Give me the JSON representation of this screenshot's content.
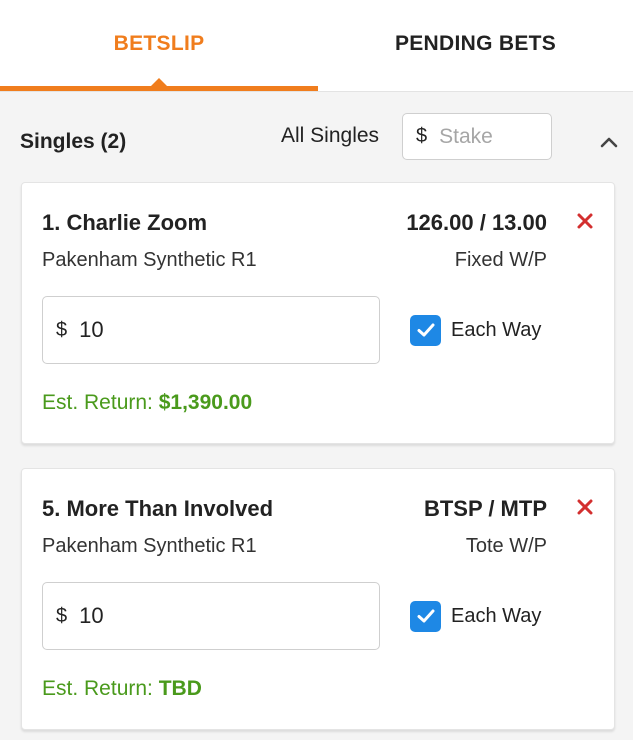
{
  "tabs": {
    "betslip": "BETSLIP",
    "pending": "PENDING BETS"
  },
  "singles": {
    "title": "Singles (2)",
    "all_singles_label": "All Singles",
    "currency": "$",
    "stake_placeholder": "Stake"
  },
  "bets": [
    {
      "runner": "1. Charlie Zoom",
      "odds": "126.00 / 13.00",
      "race": "Pakenham Synthetic R1",
      "bet_type": "Fixed W/P",
      "currency": "$",
      "stake": "10",
      "each_way_label": "Each Way",
      "each_way_checked": true,
      "est_return_label": "Est. Return:",
      "est_return_value": "$1,390.00"
    },
    {
      "runner": "5. More Than Involved",
      "odds": "BTSP / MTP",
      "race": "Pakenham Synthetic R1",
      "bet_type": "Tote W/P",
      "currency": "$",
      "stake": "10",
      "each_way_label": "Each Way",
      "each_way_checked": true,
      "est_return_label": "Est. Return:",
      "est_return_value": "TBD"
    }
  ],
  "colors": {
    "accent": "#f07d1d",
    "checkbox": "#1e88e5",
    "remove": "#d32f2f",
    "return_text": "#4a9a1c"
  },
  "icons": {
    "collapse": "chevron-up-icon",
    "remove": "close-icon",
    "checkbox": "checkmark-icon"
  }
}
